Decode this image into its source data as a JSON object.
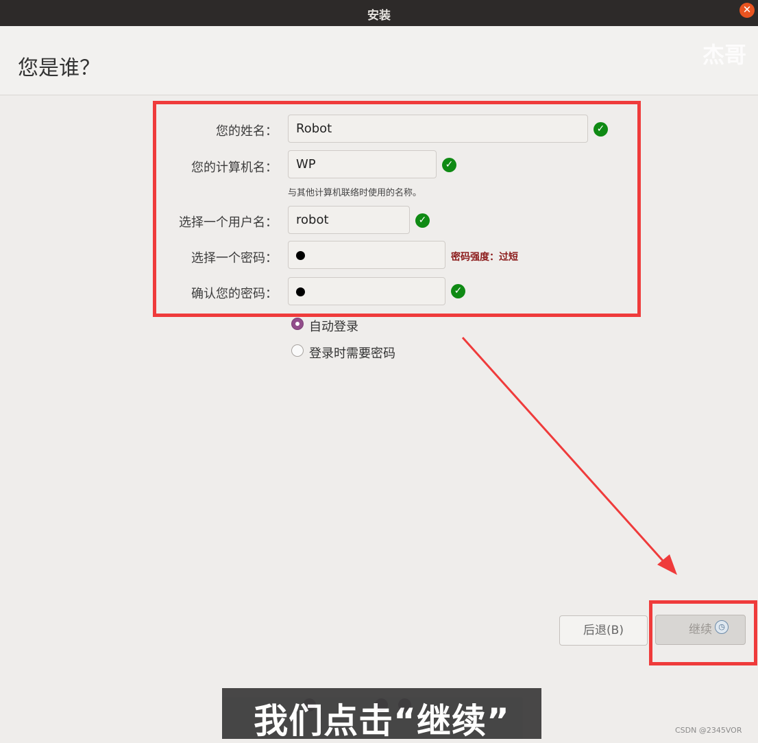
{
  "window": {
    "title": "安装",
    "close_icon": "close-icon"
  },
  "header": {
    "page_title": "您是谁？",
    "watermark": "杰哥"
  },
  "form": {
    "name_label": "您的姓名：",
    "name_value": "Robot",
    "computer_label": "您的计算机名：",
    "computer_value": "WP",
    "computer_hint": "与其他计算机联络时使用的名称。",
    "username_label": "选择一个用户名：",
    "username_value": "robot",
    "password_label": "选择一个密码：",
    "password_strength": "密码强度：过短",
    "confirm_label": "确认您的密码："
  },
  "login_options": {
    "auto_login": "自动登录",
    "require_password": "登录时需要密码",
    "selected": "auto_login"
  },
  "buttons": {
    "back": "后退(B)",
    "continue": "继续"
  },
  "overlay": {
    "caption": "我们点击“继续”",
    "credit": "CSDN @2345VOR"
  },
  "colors": {
    "highlight": "#ef3b3b",
    "success": "#0f8a14",
    "radio_accent": "#924d8b",
    "warning_text": "#8b1a1a"
  }
}
